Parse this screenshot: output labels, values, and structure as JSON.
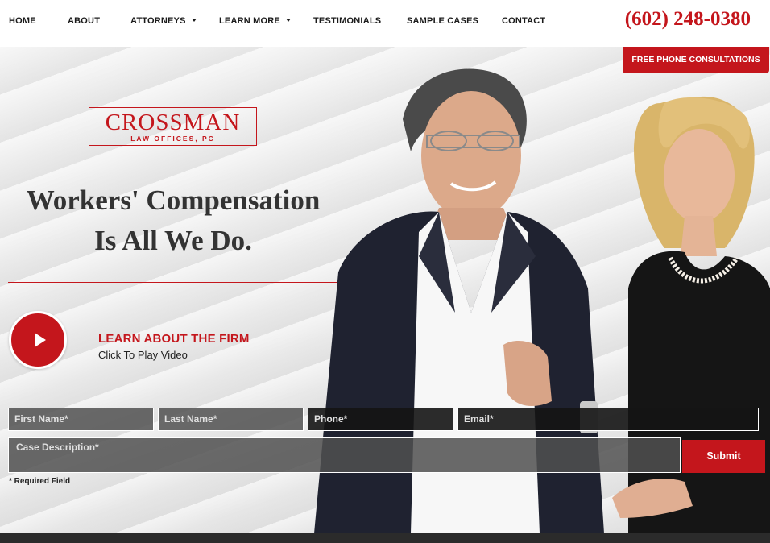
{
  "nav": {
    "items": [
      {
        "label": "HOME",
        "dropdown": false
      },
      {
        "label": "ABOUT",
        "dropdown": false
      },
      {
        "label": "ATTORNEYS",
        "dropdown": true
      },
      {
        "label": "LEARN MORE",
        "dropdown": true
      },
      {
        "label": "TESTIMONIALS",
        "dropdown": false
      },
      {
        "label": "SAMPLE CASES",
        "dropdown": false
      },
      {
        "label": "CONTACT",
        "dropdown": false
      }
    ],
    "phone": "(602) 248-0380",
    "consult_label": "FREE PHONE CONSULTATIONS"
  },
  "logo": {
    "name": "CROSSMAN",
    "sub": "LAW OFFICES, PC"
  },
  "hero": {
    "headline_line1": "Workers' Compensation",
    "headline_line2": "Is All We Do.",
    "video_title": "LEARN ABOUT THE FIRM",
    "video_sub": "Click To Play Video"
  },
  "form": {
    "first_name": "First Name*",
    "last_name": "Last Name*",
    "phone": "Phone*",
    "email": "Email*",
    "case_description": "Case Description*",
    "submit_label": "Submit",
    "required_note": "* Required Field"
  },
  "colors": {
    "accent": "#c4161c",
    "text": "#333333"
  }
}
